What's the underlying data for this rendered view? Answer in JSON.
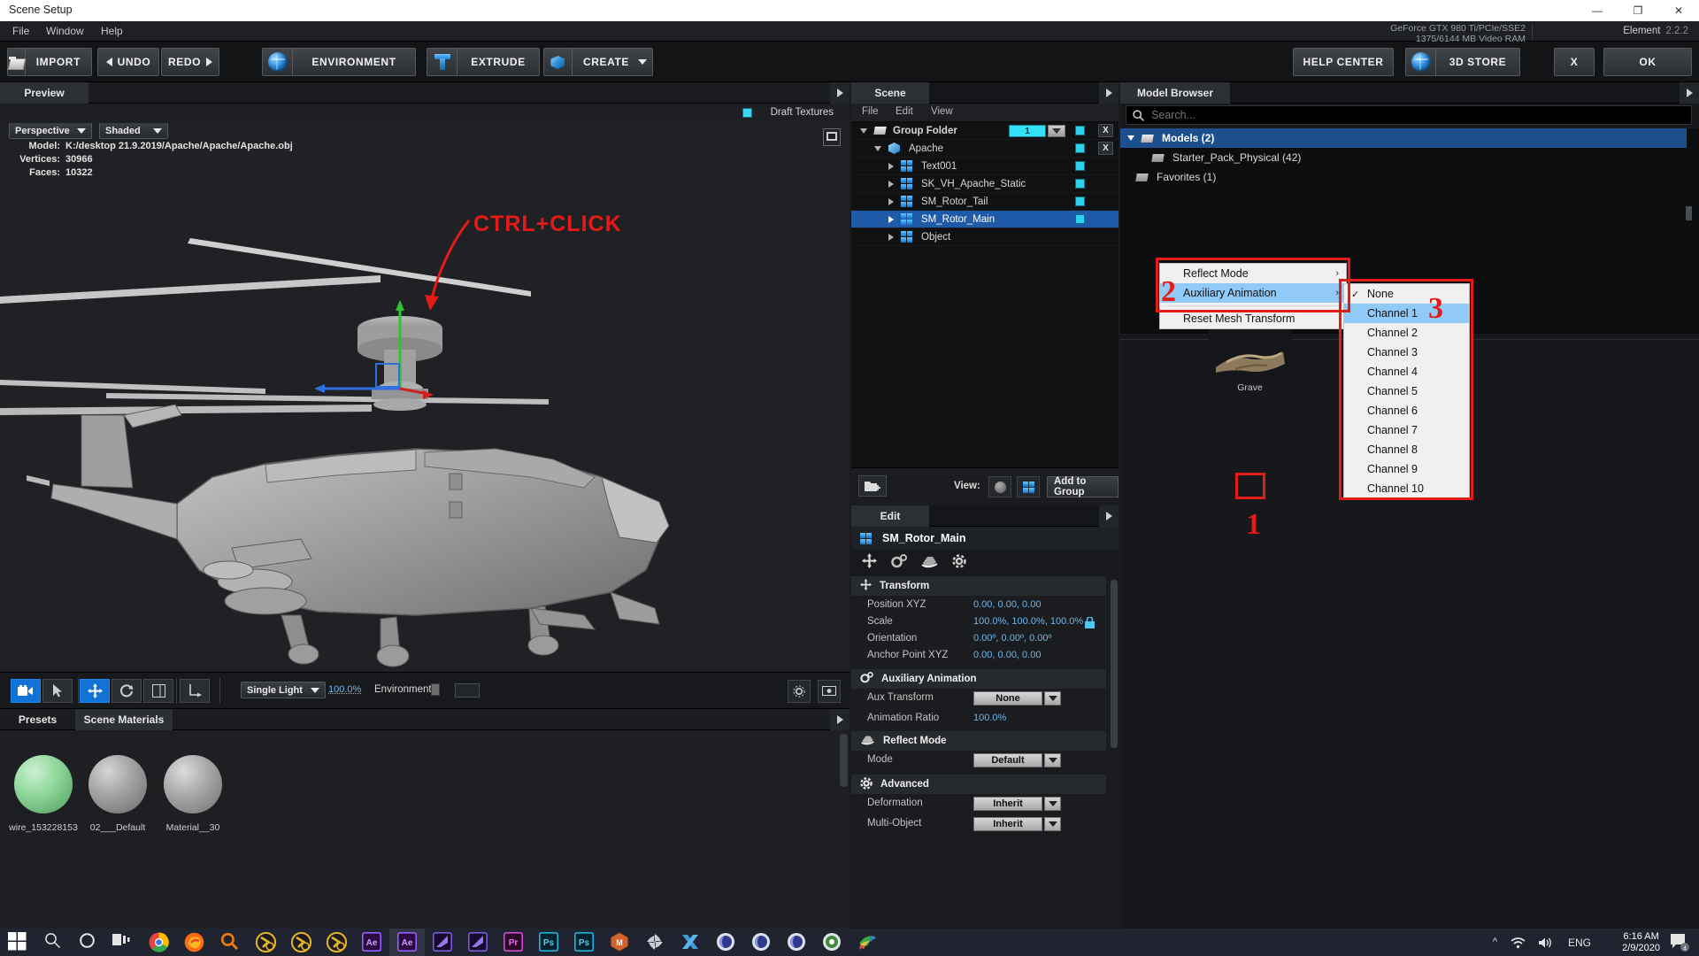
{
  "window": {
    "title": "Scene Setup",
    "minimize": "—",
    "maximize": "❐",
    "close": "✕"
  },
  "menubar": {
    "items": [
      "File",
      "Window",
      "Help"
    ]
  },
  "gpu": {
    "line1": "GeForce GTX 980 Ti/PCIe/SSE2",
    "line2": "1375/6144 MB Video RAM",
    "product": "Element",
    "version": "2.2.2"
  },
  "toolbar": {
    "import": "IMPORT",
    "undo": "UNDO",
    "redo": "REDO",
    "environment": "ENVIRONMENT",
    "extrude": "EXTRUDE",
    "create": "CREATE",
    "help_center": "HELP CENTER",
    "store": "3D STORE",
    "cancel": "X",
    "ok": "OK"
  },
  "preview": {
    "tab": "Preview",
    "draft_textures": "Draft Textures",
    "camera_mode": "Perspective",
    "shading_mode": "Shaded",
    "info": {
      "model_key": "Model:",
      "model_value": "K:/desktop 21.9.2019/Apache/Apache/Apache.obj",
      "vertices_key": "Vertices:",
      "vertices_value": "30966",
      "faces_key": "Faces:",
      "faces_value": "10322"
    },
    "annotation": "CTRL+CLICK",
    "bottom_bar": {
      "light_preset": "Single Light",
      "light_intensity": "100.0%",
      "environment_label": "Environment"
    }
  },
  "materials": {
    "tabs": [
      "Presets",
      "Scene Materials"
    ],
    "active_tab": "Scene Materials",
    "items": [
      {
        "label": "wire_153228153",
        "color": "#8fd79a"
      },
      {
        "label": "02___Default",
        "color": "#9e9e9e"
      },
      {
        "label": "Material__30",
        "color": "#a5a5a5"
      }
    ]
  },
  "scene": {
    "tab": "Scene",
    "menu": [
      "File",
      "Edit",
      "View"
    ],
    "tree": [
      {
        "label": "Group Folder",
        "icon": "folder-icon",
        "depth": 0,
        "expanded": true,
        "visible": true,
        "close": "X",
        "channel": "1"
      },
      {
        "label": "Apache",
        "icon": "cube-icon",
        "depth": 1,
        "expanded": true,
        "visible": true,
        "close": "X"
      },
      {
        "label": "Text001",
        "icon": "mesh-icon",
        "depth": 2,
        "expanded": false,
        "visible": true
      },
      {
        "label": "SK_VH_Apache_Static",
        "icon": "mesh-icon",
        "depth": 2,
        "expanded": false,
        "visible": true
      },
      {
        "label": "SM_Rotor_Tail",
        "icon": "mesh-icon",
        "depth": 2,
        "expanded": false,
        "visible": true
      },
      {
        "label": "SM_Rotor_Main",
        "icon": "mesh-icon",
        "depth": 2,
        "expanded": false,
        "visible": true,
        "selected": true
      },
      {
        "label": "Object",
        "icon": "mesh-icon",
        "depth": 2,
        "expanded": false,
        "visible": true
      }
    ],
    "footer": {
      "view_label": "View:",
      "add_to_group": "Add to Group"
    }
  },
  "context_menu": {
    "items": [
      {
        "label": "Reflect Mode",
        "submenu": true,
        "highlighted": false
      },
      {
        "label": "Auxiliary Animation",
        "submenu": true,
        "highlighted": true
      },
      {
        "label": "Reset Mesh Transform",
        "submenu": false,
        "highlighted": false
      }
    ]
  },
  "channel_menu": {
    "items": [
      {
        "label": "None",
        "checked": true,
        "highlighted": false
      },
      {
        "label": "Channel 1",
        "checked": false,
        "highlighted": true
      },
      {
        "label": "Channel 2",
        "checked": false,
        "highlighted": false
      },
      {
        "label": "Channel 3",
        "checked": false,
        "highlighted": false
      },
      {
        "label": "Channel 4",
        "checked": false,
        "highlighted": false
      },
      {
        "label": "Channel 5",
        "checked": false,
        "highlighted": false
      },
      {
        "label": "Channel 6",
        "checked": false,
        "highlighted": false
      },
      {
        "label": "Channel 7",
        "checked": false,
        "highlighted": false
      },
      {
        "label": "Channel 8",
        "checked": false,
        "highlighted": false
      },
      {
        "label": "Channel 9",
        "checked": false,
        "highlighted": false
      },
      {
        "label": "Channel 10",
        "checked": false,
        "highlighted": false
      }
    ]
  },
  "annotations": {
    "step1": "1",
    "step2": "2",
    "step3": "3",
    "accent": "#e41b17"
  },
  "edit": {
    "tab": "Edit",
    "object_name": "SM_Rotor_Main",
    "groups": [
      {
        "title": "Transform",
        "icon": "move-icon",
        "rows": [
          {
            "label": "Position XYZ",
            "values": "0.00,  0.00,  0.00",
            "type": "values"
          },
          {
            "label": "Scale",
            "values": "100.0%,  100.0%,  100.0%",
            "type": "values",
            "lock": true
          },
          {
            "label": "Orientation",
            "values": "0.00º,  0.00º,  0.00º",
            "type": "values"
          },
          {
            "label": "Anchor Point XYZ",
            "values": "0.00,  0.00,  0.00",
            "type": "values"
          }
        ]
      },
      {
        "title": "Auxiliary Animation",
        "icon": "gears-icon",
        "rows": [
          {
            "label": "Aux Transform",
            "value": "None",
            "type": "dropdown"
          },
          {
            "label": "Animation Ratio",
            "values": "100.0%",
            "type": "values"
          }
        ]
      },
      {
        "title": "Reflect Mode",
        "icon": "reflect-icon",
        "rows": [
          {
            "label": "Mode",
            "value": "Default",
            "type": "dropdown"
          }
        ]
      },
      {
        "title": "Advanced",
        "icon": "gear-icon",
        "rows": [
          {
            "label": "Deformation",
            "value": "Inherit",
            "type": "dropdown"
          },
          {
            "label": "Multi-Object",
            "value": "Inherit",
            "type": "dropdown"
          }
        ]
      }
    ]
  },
  "model_browser": {
    "tab": "Model Browser",
    "search_placeholder": "Search...",
    "tree": [
      {
        "label": "Models (2)",
        "depth": 0,
        "expanded": true,
        "selected": true
      },
      {
        "label": "Starter_Pack_Physical (42)",
        "depth": 1,
        "expanded": false,
        "selected": false
      },
      {
        "label": "Favorites (1)",
        "depth": 0,
        "expanded": false,
        "selected": false
      }
    ],
    "thumbnails": [
      {
        "label": "Grave"
      }
    ]
  },
  "taskbar": {
    "apps": [
      {
        "name": "start-icon"
      },
      {
        "name": "search-icon"
      },
      {
        "name": "cortana-icon"
      },
      {
        "name": "task-view-icon"
      },
      {
        "name": "chrome-icon"
      },
      {
        "name": "firefox-icon"
      },
      {
        "name": "everything-search-icon"
      },
      {
        "name": "utorrent-icon-1"
      },
      {
        "name": "utorrent-icon-2"
      },
      {
        "name": "utorrent-icon-3"
      },
      {
        "name": "after-effects-icon-1"
      },
      {
        "name": "after-effects-icon-2"
      },
      {
        "name": "media-encoder-icon-1"
      },
      {
        "name": "media-encoder-icon-2"
      },
      {
        "name": "premiere-pro-icon"
      },
      {
        "name": "photoshop-icon-1"
      },
      {
        "name": "photoshop-icon-2"
      },
      {
        "name": "autodesk-maya-icon"
      },
      {
        "name": "daz-studio-icon"
      },
      {
        "name": "xsplit-icon"
      },
      {
        "name": "cinema4d-icon-1"
      },
      {
        "name": "cinema4d-icon-2"
      },
      {
        "name": "cinema4d-icon-3"
      },
      {
        "name": "quicktime-icon"
      },
      {
        "name": "internet-download-manager-icon"
      }
    ],
    "tray": {
      "language": "ENG",
      "time": "6:16 AM",
      "date": "2/9/2020",
      "notification_count": "4"
    }
  }
}
